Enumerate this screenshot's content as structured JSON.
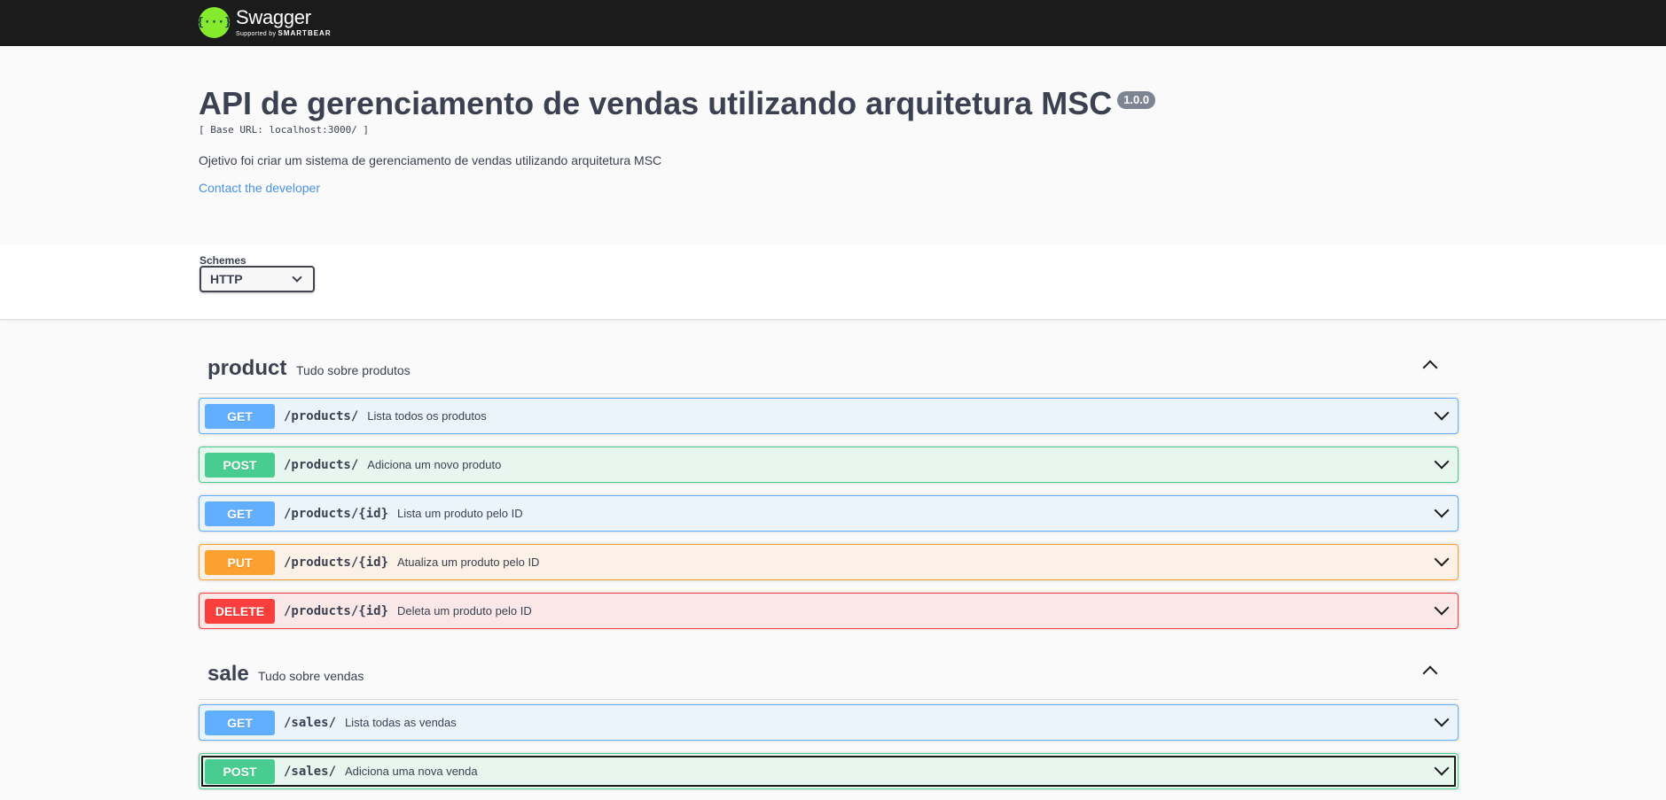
{
  "topbar": {
    "logo_glyph": "{···}",
    "logo_name": "Swagger",
    "logo_sub_prefix": "Supported by",
    "logo_sub_brand": "SMARTBEAR"
  },
  "info": {
    "title": "API de gerenciamento de vendas utilizando arquitetura MSC",
    "version": "1.0.0",
    "base_url": "[ Base URL: localhost:3000/ ]",
    "description": "Ojetivo foi criar um sistema de gerenciamento de vendas utilizando arquitetura MSC",
    "contact": "Contact the developer"
  },
  "schemes": {
    "label": "Schemes",
    "selected": "HTTP"
  },
  "tags": [
    {
      "name": "product",
      "description": "Tudo sobre produtos",
      "operations": [
        {
          "method": "GET",
          "path": "/products/",
          "summary": "Lista todos os produtos"
        },
        {
          "method": "POST",
          "path": "/products/",
          "summary": "Adiciona um novo produto"
        },
        {
          "method": "GET",
          "path": "/products/{id}",
          "summary": "Lista um produto pelo ID"
        },
        {
          "method": "PUT",
          "path": "/products/{id}",
          "summary": "Atualiza um produto pelo ID"
        },
        {
          "method": "DELETE",
          "path": "/products/{id}",
          "summary": "Deleta um produto pelo ID"
        }
      ]
    },
    {
      "name": "sale",
      "description": "Tudo sobre vendas",
      "operations": [
        {
          "method": "GET",
          "path": "/sales/",
          "summary": "Lista todas as vendas"
        },
        {
          "method": "POST",
          "path": "/sales/",
          "summary": "Adiciona uma nova venda"
        }
      ]
    }
  ],
  "colors": {
    "get": "#61affe",
    "post": "#49cc90",
    "put": "#fca130",
    "delete": "#f93e3e",
    "topbar": "#1b1b1b",
    "logo": "#85ea2d",
    "link": "#4990e2"
  }
}
